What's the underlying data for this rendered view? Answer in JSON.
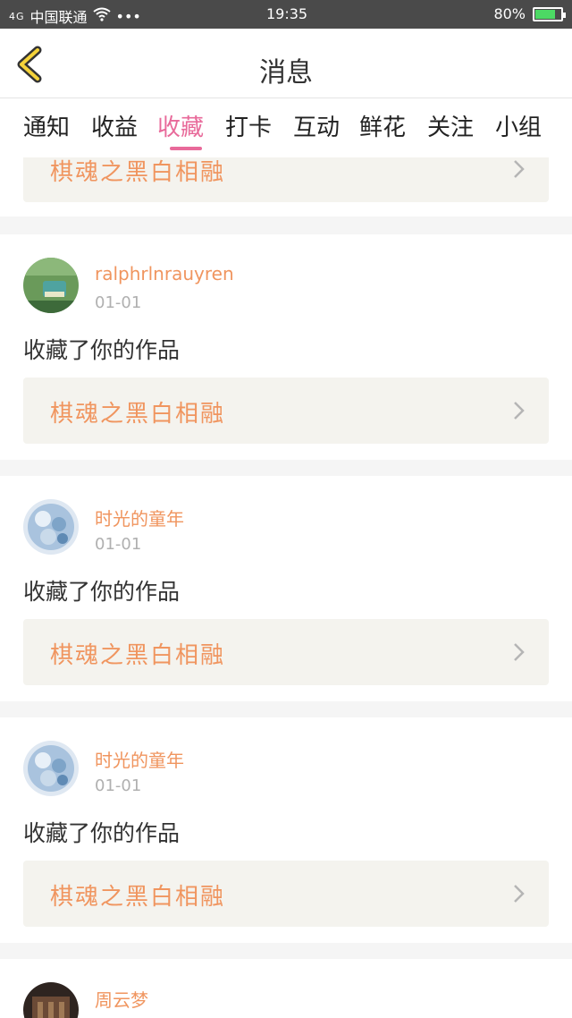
{
  "status": {
    "carrier": "中国联通",
    "network": "4G",
    "time": "19:35",
    "battery": "80%",
    "battery_level": 0.8
  },
  "nav": {
    "title": "消息",
    "back_icon": "chevron-left-icon"
  },
  "tabs": [
    {
      "label": "通知"
    },
    {
      "label": "收益"
    },
    {
      "label": "收藏",
      "active": true
    },
    {
      "label": "打卡"
    },
    {
      "label": "互动"
    },
    {
      "label": "鲜花"
    },
    {
      "label": "关注"
    },
    {
      "label": "小组"
    }
  ],
  "colors": {
    "accent": "#e86a9a",
    "username": "#f0955f",
    "status_bar": "#4a4a4a"
  },
  "partial_card": {
    "work_title": "棋魂之黑白相融"
  },
  "feed": [
    {
      "username": "ralphrlnrauyren",
      "date": "01-01",
      "action": "收藏了你的作品",
      "work_title": "棋魂之黑白相融"
    },
    {
      "username": "时光的童年",
      "date": "01-01",
      "action": "收藏了你的作品",
      "work_title": "棋魂之黑白相融"
    },
    {
      "username": "时光的童年",
      "date": "01-01",
      "action": "收藏了你的作品",
      "work_title": "棋魂之黑白相融"
    }
  ],
  "last_card": {
    "username": "周云梦"
  }
}
